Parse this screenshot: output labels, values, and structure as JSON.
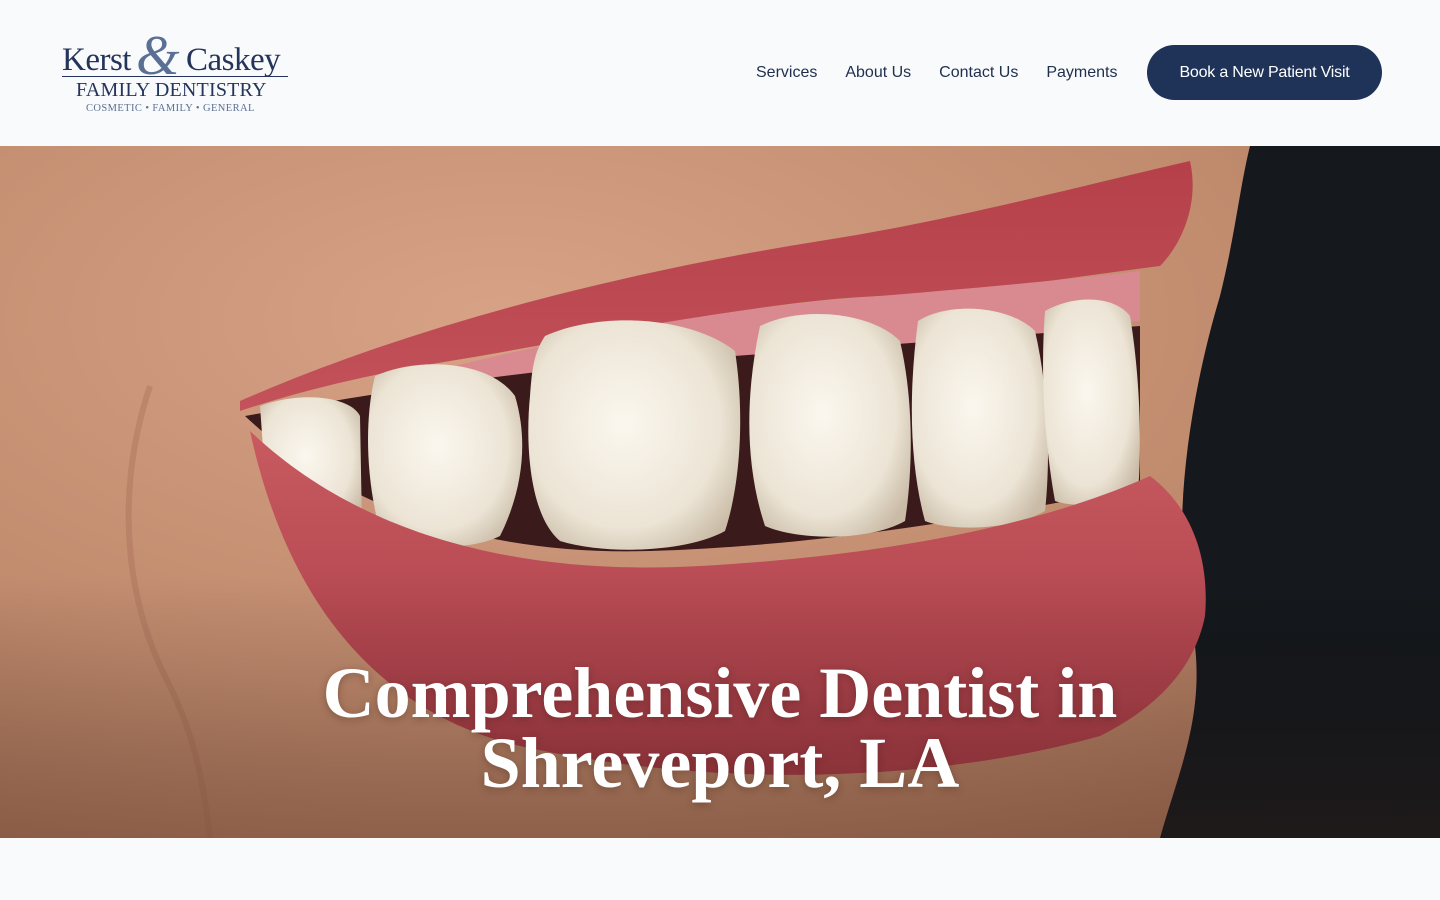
{
  "brand": {
    "name_left": "Kerst",
    "ampersand": "&",
    "name_right": "Caskey",
    "subtitle": "FAMILY DENTISTRY",
    "tagline": "COSMETIC • FAMILY • GENERAL"
  },
  "nav": {
    "items": [
      {
        "label": "Services"
      },
      {
        "label": "About Us"
      },
      {
        "label": "Contact Us"
      },
      {
        "label": "Payments"
      }
    ],
    "cta_label": "Book a New Patient Visit"
  },
  "hero": {
    "title_line1": "Comprehensive Dentist in",
    "title_line2": "Shreveport, LA",
    "image_subject": "close-up smile photo"
  },
  "colors": {
    "brand_navy": "#1f3358",
    "page_bg": "#f9fafb",
    "nav_text": "#1f2f4d"
  }
}
